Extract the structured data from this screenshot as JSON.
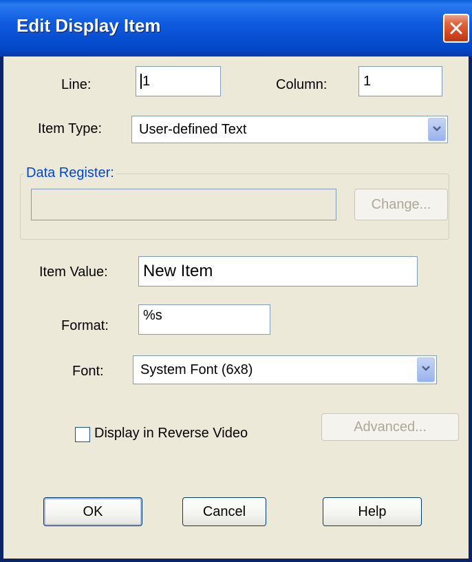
{
  "window": {
    "title": "Edit Display Item"
  },
  "line": {
    "label": "Line:",
    "value": "1"
  },
  "column": {
    "label": "Column:",
    "value": "1"
  },
  "item_type": {
    "label": "Item Type:",
    "selected": "User-defined Text"
  },
  "data_register": {
    "group_label": "Data Register:",
    "value": "",
    "change_label": "Change..."
  },
  "item_value": {
    "label": "Item Value:",
    "value": "New Item"
  },
  "format": {
    "label": "Format:",
    "value": "%s"
  },
  "font": {
    "label": "Font:",
    "selected": "System Font (6x8)"
  },
  "reverse_video": {
    "label": "Display in Reverse Video",
    "checked": false
  },
  "buttons": {
    "advanced": "Advanced...",
    "ok": "OK",
    "cancel": "Cancel",
    "help": "Help"
  },
  "colors": {
    "titlebar": "#0348C8",
    "face": "#ECE9D8",
    "group_title": "#0046D5"
  }
}
